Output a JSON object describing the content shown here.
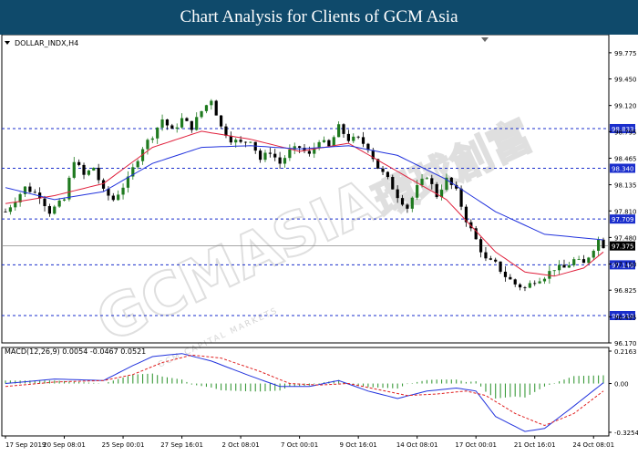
{
  "banner": {
    "title": "Chart Analysis for Clients of GCM Asia"
  },
  "watermark": {
    "brand": "GCMASIA",
    "sub": "GCM CAPITAL MARKETS",
    "cn": "環球創富"
  },
  "colors": {
    "banner_bg": "#0f4a6b",
    "up_candle": "#1f7a1f",
    "down_candle": "#000000",
    "ma_fast": "#e0203c",
    "ma_slow": "#2233dd",
    "level_line": "#1a2ecc",
    "macd_hist": "#3a9a3a",
    "macd_line": "#2233dd",
    "signal_line": "#e02020",
    "price_box": "#000000"
  },
  "chart_data": [
    {
      "type": "candlestick",
      "symbol_label": "DOLLAR_INDX,H4",
      "ylim": [
        96.17,
        100.0
      ],
      "y_ticks": [
        "99.775",
        "99.450",
        "99.120",
        "98.795",
        "98.465",
        "98.135",
        "97.810",
        "97.480",
        "97.150",
        "96.825",
        "96.495",
        "96.170"
      ],
      "x_labels": [
        "17 Sep 2019",
        "20 Sep 08:01",
        "25 Sep 00:01",
        "27 Sep 16:01",
        "2 Oct 08:01",
        "7 Oct 00:01",
        "9 Oct 16:01",
        "14 Oct 08:01",
        "17 Oct 00:01",
        "21 Oct 16:01",
        "24 Oct 08:01"
      ],
      "levels": [
        {
          "label": "98.833",
          "value": 98.833
        },
        {
          "label": "98.340",
          "value": 98.34
        },
        {
          "label": "97.709",
          "value": 97.709
        },
        {
          "label": "97.140",
          "value": 97.14
        },
        {
          "label": "96.510",
          "value": 96.51
        }
      ],
      "current_price": {
        "label": "97.375",
        "value": 97.375
      },
      "path_points": [
        [
          0,
          97.8
        ],
        [
          2,
          97.95
        ],
        [
          4,
          98.1
        ],
        [
          7,
          98.0
        ],
        [
          9,
          97.8
        ],
        [
          12,
          97.95
        ],
        [
          14,
          98.45
        ],
        [
          16,
          98.25
        ],
        [
          18,
          98.35
        ],
        [
          20,
          98.05
        ],
        [
          22,
          97.95
        ],
        [
          25,
          98.2
        ],
        [
          28,
          98.6
        ],
        [
          30,
          98.75
        ],
        [
          32,
          98.95
        ],
        [
          34,
          98.8
        ],
        [
          36,
          98.95
        ],
        [
          38,
          98.85
        ],
        [
          40,
          99.05
        ],
        [
          42,
          99.2
        ],
        [
          44,
          98.85
        ],
        [
          46,
          98.7
        ],
        [
          48,
          98.65
        ],
        [
          50,
          98.7
        ],
        [
          52,
          98.45
        ],
        [
          54,
          98.55
        ],
        [
          56,
          98.4
        ],
        [
          58,
          98.55
        ],
        [
          60,
          98.6
        ],
        [
          62,
          98.5
        ],
        [
          64,
          98.7
        ],
        [
          66,
          98.6
        ],
        [
          68,
          98.85
        ],
        [
          70,
          98.7
        ],
        [
          72,
          98.7
        ],
        [
          74,
          98.6
        ],
        [
          76,
          98.35
        ],
        [
          78,
          98.2
        ],
        [
          80,
          98.0
        ],
        [
          82,
          97.85
        ],
        [
          84,
          98.1
        ],
        [
          86,
          98.25
        ],
        [
          88,
          98.0
        ],
        [
          90,
          98.2
        ],
        [
          92,
          98.05
        ],
        [
          94,
          97.7
        ],
        [
          96,
          97.45
        ],
        [
          98,
          97.2
        ],
        [
          100,
          97.15
        ],
        [
          102,
          97.0
        ],
        [
          104,
          96.9
        ],
        [
          106,
          96.85
        ],
        [
          108,
          96.95
        ],
        [
          110,
          97.0
        ],
        [
          112,
          97.1
        ],
        [
          114,
          97.1
        ],
        [
          116,
          97.2
        ],
        [
          118,
          97.15
        ],
        [
          120,
          97.35
        ],
        [
          121,
          97.45
        ],
        [
          122,
          97.38
        ]
      ],
      "ma_fast": [
        [
          0,
          97.9
        ],
        [
          10,
          98.0
        ],
        [
          20,
          98.15
        ],
        [
          30,
          98.6
        ],
        [
          40,
          98.8
        ],
        [
          50,
          98.7
        ],
        [
          60,
          98.55
        ],
        [
          70,
          98.65
        ],
        [
          80,
          98.3
        ],
        [
          90,
          97.95
        ],
        [
          100,
          97.3
        ],
        [
          106,
          97.05
        ],
        [
          112,
          97.0
        ],
        [
          118,
          97.1
        ],
        [
          122,
          97.3
        ]
      ],
      "ma_slow": [
        [
          0,
          98.1
        ],
        [
          10,
          97.95
        ],
        [
          20,
          98.05
        ],
        [
          30,
          98.4
        ],
        [
          40,
          98.6
        ],
        [
          50,
          98.62
        ],
        [
          60,
          98.58
        ],
        [
          70,
          98.62
        ],
        [
          80,
          98.5
        ],
        [
          90,
          98.2
        ],
        [
          100,
          97.8
        ],
        [
          110,
          97.52
        ],
        [
          122,
          97.45
        ]
      ]
    },
    {
      "type": "macd",
      "label": "MACD(12,26,9) 0.0054 -0.0467 0.0521",
      "ylim": [
        -0.3254,
        0.2163
      ],
      "y_ticks": [
        "0.2163",
        "0.00",
        "-0.3254"
      ],
      "macd_line": [
        [
          0,
          0.0
        ],
        [
          10,
          0.03
        ],
        [
          20,
          0.02
        ],
        [
          26,
          0.12
        ],
        [
          30,
          0.18
        ],
        [
          36,
          0.2
        ],
        [
          42,
          0.15
        ],
        [
          50,
          0.05
        ],
        [
          56,
          -0.02
        ],
        [
          62,
          -0.02
        ],
        [
          68,
          0.02
        ],
        [
          74,
          -0.05
        ],
        [
          80,
          -0.1
        ],
        [
          86,
          -0.05
        ],
        [
          92,
          -0.03
        ],
        [
          96,
          -0.05
        ],
        [
          100,
          -0.22
        ],
        [
          106,
          -0.32
        ],
        [
          110,
          -0.3
        ],
        [
          116,
          -0.15
        ],
        [
          122,
          0.005
        ]
      ],
      "signal_line": [
        [
          0,
          -0.02
        ],
        [
          10,
          0.01
        ],
        [
          20,
          0.02
        ],
        [
          26,
          0.06
        ],
        [
          32,
          0.14
        ],
        [
          38,
          0.19
        ],
        [
          44,
          0.17
        ],
        [
          52,
          0.08
        ],
        [
          58,
          0.0
        ],
        [
          64,
          -0.01
        ],
        [
          70,
          0.0
        ],
        [
          76,
          -0.04
        ],
        [
          82,
          -0.08
        ],
        [
          88,
          -0.07
        ],
        [
          94,
          -0.05
        ],
        [
          98,
          -0.08
        ],
        [
          104,
          -0.2
        ],
        [
          110,
          -0.28
        ],
        [
          116,
          -0.2
        ],
        [
          122,
          -0.05
        ]
      ]
    }
  ]
}
